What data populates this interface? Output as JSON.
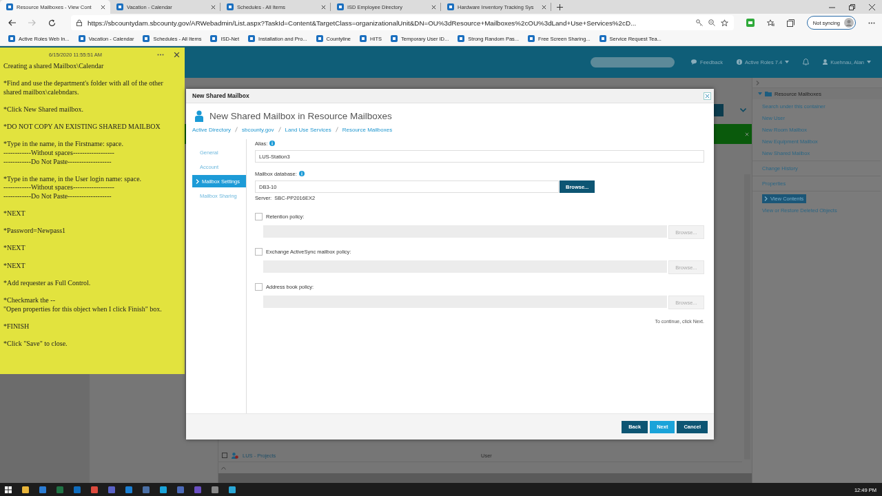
{
  "browser": {
    "tabs": [
      {
        "title": "Resource Mailboxes - View Cont",
        "selected": true
      },
      {
        "title": "Vacation - Calendar",
        "selected": false
      },
      {
        "title": "Schedules - All Items",
        "selected": false
      },
      {
        "title": "ISD Employee Directory",
        "selected": false
      },
      {
        "title": "Hardware Inventory Tracking Sys",
        "selected": false
      }
    ],
    "url": "https://sbcountydam.sbcounty.gov/ARWebadmin/List.aspx?TaskId=Content&TargetClass=organizationalUnit&DN=OU%3dResource+Mailboxes%2cOU%3dLand+Use+Services%2cD...",
    "profile": "Not syncing",
    "bookmarks": [
      "Active Roles Web In...",
      "Vacation - Calendar",
      "Schedules - All Items",
      "ISD-Net",
      "Installation and Pro...",
      "Countyline",
      "HITS",
      "Temporary User ID...",
      "Strong Random Pas...",
      "Free Screen Sharing...",
      "Service Request Tea..."
    ]
  },
  "sticky_note": {
    "timestamp": "6/15/2020 11:55:51 AM",
    "paragraphs": [
      [
        "Creating a shared Mailbox\\Calendar"
      ],
      [
        "*Find and use the department's folder with all of the other shared mailbox\\calebndars."
      ],
      [
        "*Click New Shared mailbox."
      ],
      [
        "*DO NOT COPY AN EXISTING SHARED MAILBOX"
      ],
      [
        "*Type in the name, in the Firstname: space.",
        "------------Without spaces------------------",
        "------------Do Not Paste-------------------"
      ],
      [
        "*Type in the name, in the User login name: space.",
        "------------Without spaces------------------",
        "------------Do Not Paste-------------------"
      ],
      [
        "*NEXT"
      ],
      [
        "*Password=Newpass1"
      ],
      [
        "*NEXT"
      ],
      [
        "*NEXT"
      ],
      [
        "*Add requester as Full Control."
      ],
      [
        "*Checkmark the --",
        "\"Open properties for this object when I click Finish\" box."
      ],
      [
        "*FINISH"
      ],
      [
        "*Click \"Save\" to close."
      ]
    ]
  },
  "app_header": {
    "feedback": "Feedback",
    "version": "Active Roles 7.4",
    "user": "Kuehnau, Alan"
  },
  "list_row": {
    "name": "LUS - Projects",
    "type": "User",
    "checked": false
  },
  "right_panel": {
    "title": "Resource Mailboxes",
    "action_groups": [
      [
        {
          "label": "Search under this container",
          "selected": false
        },
        {
          "label": "New User",
          "selected": false
        },
        {
          "label": "New Room Mailbox",
          "selected": false
        },
        {
          "label": "New Equipment Mailbox",
          "selected": false
        },
        {
          "label": "New Shared Mailbox",
          "selected": false
        }
      ],
      [
        {
          "label": "Change History",
          "selected": false
        }
      ],
      [
        {
          "label": "Properties",
          "selected": false
        }
      ],
      [
        {
          "label": "View Contents",
          "selected": true
        },
        {
          "label": "View or Restore Deleted Objects",
          "selected": false
        }
      ]
    ]
  },
  "dialog": {
    "title": "New Shared Mailbox",
    "heading": "New Shared Mailbox in Resource Mailboxes",
    "breadcrumb": [
      "Active Directory",
      "sbcounty.gov",
      "Land Use Services",
      "Resource Mailboxes"
    ],
    "steps": [
      {
        "label": "General",
        "selected": false
      },
      {
        "label": "Account",
        "selected": false
      },
      {
        "label": "Mailbox Settings",
        "selected": true
      },
      {
        "label": "Mailbox Sharing",
        "selected": false
      }
    ],
    "alias": {
      "label": "Alias:",
      "value": "LUS-Station3"
    },
    "database": {
      "label": "Mailbox database:",
      "value": "DB3-10",
      "button": "Browse...",
      "server": "Server:  SBC-PP2016EX2"
    },
    "policies": [
      {
        "label": "Retention policy:",
        "checked": false,
        "button": "Browse..."
      },
      {
        "label": "Exchange ActiveSync mailbox policy:",
        "checked": false,
        "button": "Browse..."
      },
      {
        "label": "Address book policy:",
        "checked": false,
        "button": "Browse..."
      }
    ],
    "hint": "To continue, click Next.",
    "buttons": [
      {
        "label": "Back",
        "kind": "secondary"
      },
      {
        "label": "Next",
        "kind": "primary"
      },
      {
        "label": "Cancel",
        "kind": "secondary"
      }
    ]
  },
  "taskbar": {
    "time": "12:49 PM"
  }
}
